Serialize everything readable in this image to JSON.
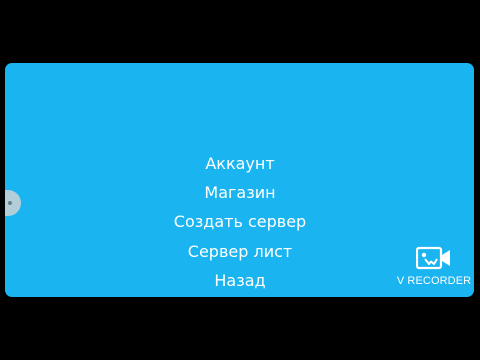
{
  "menu": {
    "items": [
      {
        "label": "Аккаунт"
      },
      {
        "label": "Магазин"
      },
      {
        "label": "Создать сервер"
      },
      {
        "label": "Сервер лист"
      },
      {
        "label": "Назад"
      }
    ]
  },
  "watermark": {
    "icon": "video-camera-icon",
    "text": "V RECORDER"
  },
  "colors": {
    "background": "#000000",
    "panel": "#1ab4f0",
    "text": "#ffffff",
    "edge_handle": "#cfd3d6"
  }
}
